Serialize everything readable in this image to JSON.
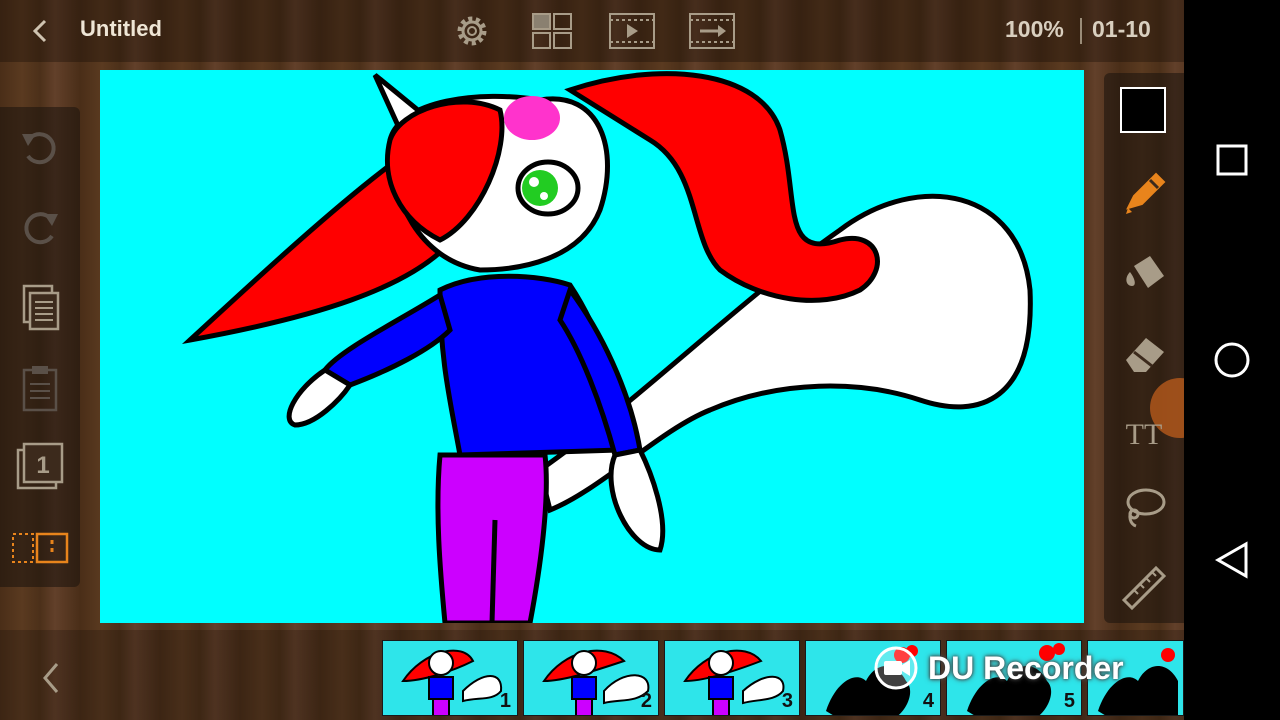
{
  "header": {
    "title": "Untitled",
    "zoom": "100%",
    "frame_range": "01-10"
  },
  "icons": {
    "back": "chevron-left-icon",
    "settings": "gear-icon",
    "layers": "grid-icon",
    "play": "film-play-icon",
    "export": "film-export-icon",
    "undo": "undo-icon",
    "redo": "redo-icon",
    "copy": "copy-icon",
    "paste": "clipboard-icon",
    "layer": "layer-1-icon",
    "frame_mode": "frame-select-icon",
    "pencil": "pencil-icon",
    "fill": "bucket-icon",
    "eraser": "eraser-icon",
    "text": "text-icon",
    "lasso": "lasso-icon",
    "ruler": "ruler-icon"
  },
  "layer_number": "1",
  "tools": {
    "current_color": "#000000",
    "text_label": "TT"
  },
  "timeline": {
    "frames": [
      {
        "number": "1"
      },
      {
        "number": "2"
      },
      {
        "number": "3"
      },
      {
        "number": "4"
      },
      {
        "number": "5"
      },
      {
        "number": ""
      }
    ]
  },
  "watermark": {
    "text": "DU Recorder"
  },
  "colors": {
    "canvas_bg": "#00ffff",
    "hair": "#ff0000",
    "shirt": "#0000ff",
    "pants": "#cc00ff",
    "eye": "#22cc22",
    "bow": "#ff33cc",
    "accent_orange": "#e8841c"
  }
}
